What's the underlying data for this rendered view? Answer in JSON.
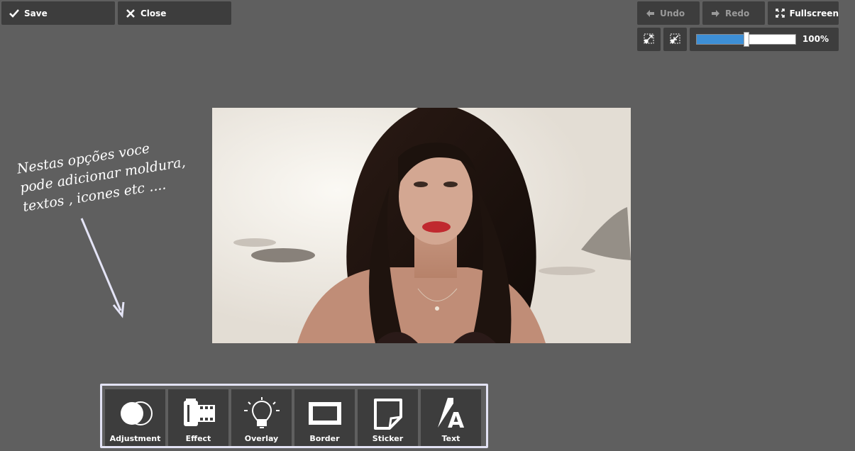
{
  "toolbar_top": {
    "save_label": "Save",
    "close_label": "Close",
    "undo_label": "Undo",
    "redo_label": "Redo",
    "fullscreen_label": "Fullscreen"
  },
  "zoom": {
    "label": "100%",
    "level_fraction": 0.5
  },
  "annotation": {
    "text": "Nestas opções voce\npode adicionar moldura,\ntextos , icones etc ...."
  },
  "tools": [
    {
      "label": "Adjustment",
      "icon": "adjustment-icon"
    },
    {
      "label": "Effect",
      "icon": "film-effect-icon"
    },
    {
      "label": "Overlay",
      "icon": "lightbulb-overlay-icon"
    },
    {
      "label": "Border",
      "icon": "frame-border-icon"
    },
    {
      "label": "Sticker",
      "icon": "sticker-icon"
    },
    {
      "label": "Text",
      "icon": "text-icon"
    }
  ],
  "colors": {
    "background": "#5f5f5f",
    "button": "#3d3d3d",
    "zoom_fill": "#3d8fd6",
    "toolbar_border": "#e2e2f4"
  }
}
